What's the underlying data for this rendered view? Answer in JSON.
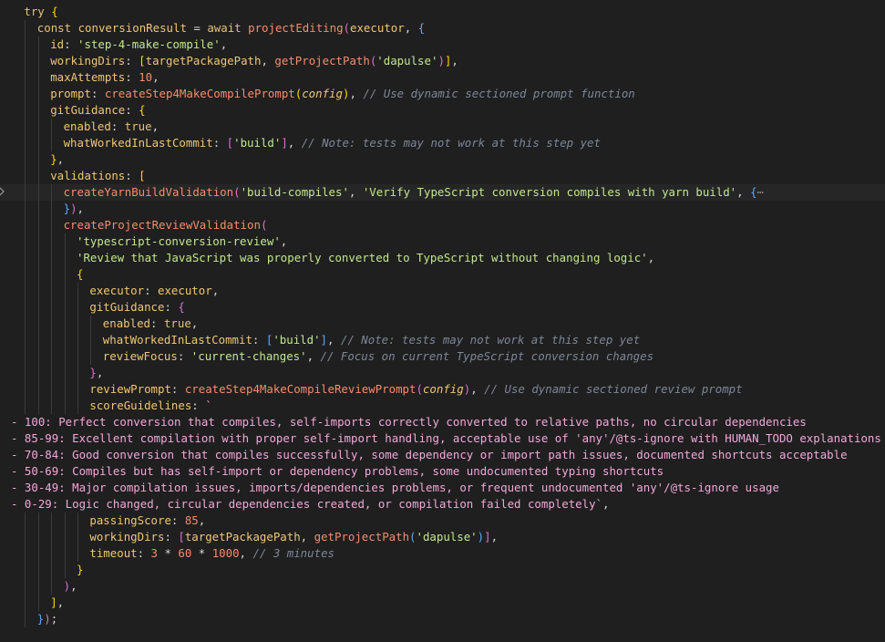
{
  "editor": {
    "language": "typescript",
    "theme_colors": {
      "background": "#1f1f1f",
      "active_line": "#262626",
      "keyword": "#e5c07b",
      "string": "#c3e88d",
      "property": "#f0c674",
      "function": "#f78c6c",
      "number": "#f78c6c",
      "comment": "#7d8799",
      "template_string": "#f2a8d9"
    },
    "lines": [
      {
        "indent": 1,
        "tokens": [
          [
            "kw",
            "try"
          ],
          [
            "pl",
            " "
          ],
          [
            "b1",
            "{"
          ]
        ]
      },
      {
        "indent": 2,
        "tokens": [
          [
            "kw",
            "const"
          ],
          [
            "pl",
            " "
          ],
          [
            "pr",
            "conversionResult"
          ],
          [
            "pl",
            " = "
          ],
          [
            "kw",
            "await"
          ],
          [
            "pl",
            " "
          ],
          [
            "fn",
            "projectEditing"
          ],
          [
            "b2",
            "("
          ],
          [
            "pr",
            "executor"
          ],
          [
            "pl",
            ", "
          ],
          [
            "b3",
            "{"
          ]
        ]
      },
      {
        "indent": 3,
        "tokens": [
          [
            "pr",
            "id"
          ],
          [
            "pl",
            ": "
          ],
          [
            "st",
            "'step-4-make-compile'"
          ],
          [
            "pl",
            ","
          ]
        ]
      },
      {
        "indent": 3,
        "tokens": [
          [
            "pr",
            "workingDirs"
          ],
          [
            "pl",
            ": "
          ],
          [
            "b1",
            "["
          ],
          [
            "pr",
            "targetPackagePath"
          ],
          [
            "pl",
            ", "
          ],
          [
            "fn",
            "getProjectPath"
          ],
          [
            "b2",
            "("
          ],
          [
            "st",
            "'dapulse'"
          ],
          [
            "b2",
            ")"
          ],
          [
            "b1",
            "]"
          ],
          [
            "pl",
            ","
          ]
        ]
      },
      {
        "indent": 3,
        "tokens": [
          [
            "pr",
            "maxAttempts"
          ],
          [
            "pl",
            ": "
          ],
          [
            "nm",
            "10"
          ],
          [
            "pl",
            ","
          ]
        ]
      },
      {
        "indent": 3,
        "tokens": [
          [
            "pr",
            "prompt"
          ],
          [
            "pl",
            ": "
          ],
          [
            "fn",
            "createStep4MakeCompilePrompt"
          ],
          [
            "b1",
            "("
          ],
          [
            "it",
            "config"
          ],
          [
            "b1",
            ")"
          ],
          [
            "pl",
            ", "
          ],
          [
            "cm",
            "// Use dynamic sectioned prompt function"
          ]
        ]
      },
      {
        "indent": 3,
        "tokens": [
          [
            "pr",
            "gitGuidance"
          ],
          [
            "pl",
            ": "
          ],
          [
            "b1",
            "{"
          ]
        ]
      },
      {
        "indent": 4,
        "tokens": [
          [
            "pr",
            "enabled"
          ],
          [
            "pl",
            ": "
          ],
          [
            "kw",
            "true"
          ],
          [
            "pl",
            ","
          ]
        ]
      },
      {
        "indent": 4,
        "tokens": [
          [
            "pr",
            "whatWorkedInLastCommit"
          ],
          [
            "pl",
            ": "
          ],
          [
            "b2",
            "["
          ],
          [
            "st",
            "'build'"
          ],
          [
            "b2",
            "]"
          ],
          [
            "pl",
            ", "
          ],
          [
            "cm",
            "// Note: tests may not work at this step yet"
          ]
        ]
      },
      {
        "indent": 3,
        "tokens": [
          [
            "b1",
            "}"
          ],
          [
            "pl",
            ","
          ]
        ]
      },
      {
        "indent": 3,
        "tokens": [
          [
            "pr",
            "validations"
          ],
          [
            "pl",
            ": "
          ],
          [
            "b1",
            "["
          ]
        ]
      },
      {
        "indent": 4,
        "active": true,
        "fold": true,
        "tokens": [
          [
            "fn",
            "createYarnBuildValidation"
          ],
          [
            "b2",
            "("
          ],
          [
            "st",
            "'build-compiles'"
          ],
          [
            "pl",
            ", "
          ],
          [
            "st",
            "'Verify TypeScript conversion compiles with yarn build'"
          ],
          [
            "pl",
            ", "
          ],
          [
            "b3",
            "{"
          ],
          [
            "ellipsis",
            "⋯"
          ]
        ]
      },
      {
        "indent": 4,
        "tokens": [
          [
            "b3",
            "}"
          ],
          [
            "b2",
            ")"
          ],
          [
            "pl",
            ","
          ]
        ]
      },
      {
        "indent": 4,
        "tokens": [
          [
            "fn",
            "createProjectReviewValidation"
          ],
          [
            "b2",
            "("
          ]
        ]
      },
      {
        "indent": 5,
        "tokens": [
          [
            "st",
            "'typescript-conversion-review'"
          ],
          [
            "pl",
            ","
          ]
        ]
      },
      {
        "indent": 5,
        "tokens": [
          [
            "st",
            "'Review that JavaScript was properly converted to TypeScript without changing logic'"
          ],
          [
            "pl",
            ","
          ]
        ]
      },
      {
        "indent": 5,
        "tokens": [
          [
            "b1",
            "{"
          ]
        ]
      },
      {
        "indent": 6,
        "tokens": [
          [
            "pr",
            "executor"
          ],
          [
            "pl",
            ": "
          ],
          [
            "pr",
            "executor"
          ],
          [
            "pl",
            ","
          ]
        ]
      },
      {
        "indent": 6,
        "tokens": [
          [
            "pr",
            "gitGuidance"
          ],
          [
            "pl",
            ": "
          ],
          [
            "b2",
            "{"
          ]
        ]
      },
      {
        "indent": 7,
        "tokens": [
          [
            "pr",
            "enabled"
          ],
          [
            "pl",
            ": "
          ],
          [
            "kw",
            "true"
          ],
          [
            "pl",
            ","
          ]
        ]
      },
      {
        "indent": 7,
        "tokens": [
          [
            "pr",
            "whatWorkedInLastCommit"
          ],
          [
            "pl",
            ": "
          ],
          [
            "b3",
            "["
          ],
          [
            "st",
            "'build'"
          ],
          [
            "b3",
            "]"
          ],
          [
            "pl",
            ", "
          ],
          [
            "cm",
            "// Note: tests may not work at this step yet"
          ]
        ]
      },
      {
        "indent": 7,
        "tokens": [
          [
            "pr",
            "reviewFocus"
          ],
          [
            "pl",
            ": "
          ],
          [
            "st",
            "'current-changes'"
          ],
          [
            "pl",
            ", "
          ],
          [
            "cm",
            "// Focus on current TypeScript conversion changes"
          ]
        ]
      },
      {
        "indent": 6,
        "tokens": [
          [
            "b2",
            "}"
          ],
          [
            "pl",
            ","
          ]
        ]
      },
      {
        "indent": 6,
        "tokens": [
          [
            "pr",
            "reviewPrompt"
          ],
          [
            "pl",
            ": "
          ],
          [
            "fn",
            "createStep4MakeCompileReviewPrompt"
          ],
          [
            "b2",
            "("
          ],
          [
            "it",
            "config"
          ],
          [
            "b2",
            ")"
          ],
          [
            "pl",
            ", "
          ],
          [
            "cm",
            "// Use dynamic sectioned review prompt"
          ]
        ]
      },
      {
        "indent": 6,
        "tokens": [
          [
            "pr",
            "scoreGuidelines"
          ],
          [
            "pl",
            ": "
          ],
          [
            "ts",
            "`"
          ]
        ]
      },
      {
        "indent": 0,
        "tokens": [
          [
            "ts",
            "- 100: Perfect conversion that compiles, self-imports correctly converted to relative paths, no circular dependencies"
          ]
        ]
      },
      {
        "indent": 0,
        "tokens": [
          [
            "ts",
            "- 85-99: Excellent compilation with proper self-import handling, acceptable use of 'any'/@ts-ignore with HUMAN_TODO explanations"
          ]
        ]
      },
      {
        "indent": 0,
        "tokens": [
          [
            "ts",
            "- 70-84: Good conversion that compiles successfully, some dependency or import path issues, documented shortcuts acceptable"
          ]
        ]
      },
      {
        "indent": 0,
        "tokens": [
          [
            "ts",
            "- 50-69: Compiles but has self-import or dependency problems, some undocumented typing shortcuts"
          ]
        ]
      },
      {
        "indent": 0,
        "tokens": [
          [
            "ts",
            "- 30-49: Major compilation issues, imports/dependencies problems, or frequent undocumented 'any'/@ts-ignore usage"
          ]
        ]
      },
      {
        "indent": 0,
        "tokens": [
          [
            "ts",
            "- 0-29: Logic changed, circular dependencies created, or compilation failed completely`"
          ],
          [
            "pl",
            ","
          ]
        ]
      },
      {
        "indent": 6,
        "tokens": [
          [
            "pr",
            "passingScore"
          ],
          [
            "pl",
            ": "
          ],
          [
            "nm",
            "85"
          ],
          [
            "pl",
            ","
          ]
        ]
      },
      {
        "indent": 6,
        "tokens": [
          [
            "pr",
            "workingDirs"
          ],
          [
            "pl",
            ": "
          ],
          [
            "b2",
            "["
          ],
          [
            "pr",
            "targetPackagePath"
          ],
          [
            "pl",
            ", "
          ],
          [
            "fn",
            "getProjectPath"
          ],
          [
            "b3",
            "("
          ],
          [
            "st",
            "'dapulse'"
          ],
          [
            "b3",
            ")"
          ],
          [
            "b2",
            "]"
          ],
          [
            "pl",
            ","
          ]
        ]
      },
      {
        "indent": 6,
        "tokens": [
          [
            "pr",
            "timeout"
          ],
          [
            "pl",
            ": "
          ],
          [
            "nm",
            "3"
          ],
          [
            "pl",
            " * "
          ],
          [
            "nm",
            "60"
          ],
          [
            "pl",
            " * "
          ],
          [
            "nm",
            "1000"
          ],
          [
            "pl",
            ", "
          ],
          [
            "cm",
            "// 3 minutes"
          ]
        ]
      },
      {
        "indent": 5,
        "tokens": [
          [
            "b1",
            "}"
          ]
        ]
      },
      {
        "indent": 4,
        "tokens": [
          [
            "b2",
            ")"
          ],
          [
            "pl",
            ","
          ]
        ]
      },
      {
        "indent": 3,
        "tokens": [
          [
            "b1",
            "]"
          ],
          [
            "pl",
            ","
          ]
        ]
      },
      {
        "indent": 2,
        "tokens": [
          [
            "b3",
            "}"
          ],
          [
            "b2",
            ")"
          ],
          [
            "pl",
            ";"
          ]
        ]
      },
      {
        "indent": 0,
        "tokens": []
      }
    ]
  }
}
